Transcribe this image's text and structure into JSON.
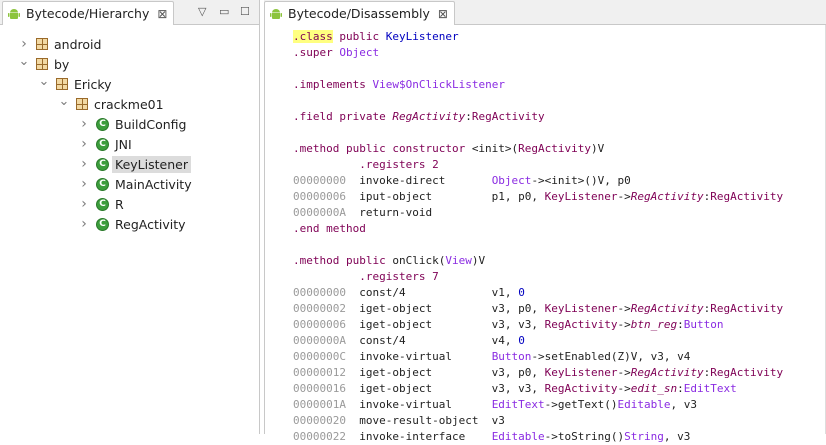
{
  "left_tab": {
    "title": "Bytecode/Hierarchy",
    "close": "⊠"
  },
  "left_controls": {
    "menu": "▽",
    "minimize": "▭",
    "maximize": "☐"
  },
  "tree": [
    {
      "label": "android",
      "type": "package",
      "depth": 0,
      "expanded": false
    },
    {
      "label": "by",
      "type": "package",
      "depth": 0,
      "expanded": true
    },
    {
      "label": "Ericky",
      "type": "package",
      "depth": 1,
      "expanded": true
    },
    {
      "label": "crackme01",
      "type": "package",
      "depth": 2,
      "expanded": true
    },
    {
      "label": "BuildConfig",
      "type": "class",
      "depth": 3,
      "expanded": false
    },
    {
      "label": "JNI",
      "type": "class",
      "depth": 3,
      "expanded": false
    },
    {
      "label": "KeyListener",
      "type": "class",
      "depth": 3,
      "expanded": false,
      "selected": true
    },
    {
      "label": "MainActivity",
      "type": "class",
      "depth": 3,
      "expanded": false
    },
    {
      "label": "R",
      "type": "class",
      "depth": 3,
      "expanded": false
    },
    {
      "label": "RegActivity",
      "type": "class",
      "depth": 3,
      "expanded": false
    }
  ],
  "class_icon_letter": "C",
  "right_tab": {
    "title": "Bytecode/Disassembly",
    "close": "⊠"
  },
  "code_lines": [
    [
      {
        "t": ".class",
        "c": "kw hilite"
      },
      {
        "t": " public ",
        "c": "kw"
      },
      {
        "t": "KeyListener",
        "c": "id"
      }
    ],
    [
      {
        "t": ".super ",
        "c": "kw"
      },
      {
        "t": "Object",
        "c": "type"
      }
    ],
    [],
    [
      {
        "t": ".implements ",
        "c": "kw"
      },
      {
        "t": "View$OnClickListener",
        "c": "type"
      }
    ],
    [],
    [
      {
        "t": ".field private ",
        "c": "kw"
      },
      {
        "t": "RegActivity",
        "c": "cls it"
      },
      {
        "t": ":",
        "c": "plain"
      },
      {
        "t": "RegActivity",
        "c": "cls"
      }
    ],
    [],
    [
      {
        "t": ".method public constructor ",
        "c": "kw"
      },
      {
        "t": "<init>(",
        "c": "plain"
      },
      {
        "t": "RegActivity",
        "c": "cls"
      },
      {
        "t": ")V",
        "c": "plain"
      }
    ],
    [
      {
        "t": "          .registers 2",
        "c": "kw"
      }
    ],
    [
      {
        "t": "00000000  ",
        "c": "gray"
      },
      {
        "t": "invoke-direct       ",
        "c": "plain"
      },
      {
        "t": "Object",
        "c": "type"
      },
      {
        "t": "-><init>()V, p0",
        "c": "plain"
      }
    ],
    [
      {
        "t": "00000006  ",
        "c": "gray"
      },
      {
        "t": "iput-object         p1, p0, ",
        "c": "plain"
      },
      {
        "t": "KeyListener",
        "c": "cls"
      },
      {
        "t": "->",
        "c": "plain"
      },
      {
        "t": "RegActivity",
        "c": "cls it"
      },
      {
        "t": ":",
        "c": "plain"
      },
      {
        "t": "RegActivity",
        "c": "cls"
      }
    ],
    [
      {
        "t": "0000000A  ",
        "c": "gray"
      },
      {
        "t": "return-void",
        "c": "plain"
      }
    ],
    [
      {
        "t": ".end method",
        "c": "kw"
      }
    ],
    [],
    [
      {
        "t": ".method public ",
        "c": "kw"
      },
      {
        "t": "onClick(",
        "c": "plain"
      },
      {
        "t": "View",
        "c": "type"
      },
      {
        "t": ")V",
        "c": "plain"
      }
    ],
    [
      {
        "t": "          .registers 7",
        "c": "kw"
      }
    ],
    [
      {
        "t": "00000000  ",
        "c": "gray"
      },
      {
        "t": "const/4             v1, ",
        "c": "plain"
      },
      {
        "t": "0",
        "c": "id"
      }
    ],
    [
      {
        "t": "00000002  ",
        "c": "gray"
      },
      {
        "t": "iget-object         v3, p0, ",
        "c": "plain"
      },
      {
        "t": "KeyListener",
        "c": "cls"
      },
      {
        "t": "->",
        "c": "plain"
      },
      {
        "t": "RegActivity",
        "c": "cls it"
      },
      {
        "t": ":",
        "c": "plain"
      },
      {
        "t": "RegActivity",
        "c": "cls"
      }
    ],
    [
      {
        "t": "00000006  ",
        "c": "gray"
      },
      {
        "t": "iget-object         v3, v3, ",
        "c": "plain"
      },
      {
        "t": "RegActivity",
        "c": "cls"
      },
      {
        "t": "->",
        "c": "plain"
      },
      {
        "t": "btn_reg",
        "c": "cls it"
      },
      {
        "t": ":",
        "c": "plain"
      },
      {
        "t": "Button",
        "c": "type"
      }
    ],
    [
      {
        "t": "0000000A  ",
        "c": "gray"
      },
      {
        "t": "const/4             v4, ",
        "c": "plain"
      },
      {
        "t": "0",
        "c": "id"
      }
    ],
    [
      {
        "t": "0000000C  ",
        "c": "gray"
      },
      {
        "t": "invoke-virtual      ",
        "c": "plain"
      },
      {
        "t": "Button",
        "c": "type"
      },
      {
        "t": "->setEnabled(Z)V, v3, v4",
        "c": "plain"
      }
    ],
    [
      {
        "t": "00000012  ",
        "c": "gray"
      },
      {
        "t": "iget-object         v3, p0, ",
        "c": "plain"
      },
      {
        "t": "KeyListener",
        "c": "cls"
      },
      {
        "t": "->",
        "c": "plain"
      },
      {
        "t": "RegActivity",
        "c": "cls it"
      },
      {
        "t": ":",
        "c": "plain"
      },
      {
        "t": "RegActivity",
        "c": "cls"
      }
    ],
    [
      {
        "t": "00000016  ",
        "c": "gray"
      },
      {
        "t": "iget-object         v3, v3, ",
        "c": "plain"
      },
      {
        "t": "RegActivity",
        "c": "cls"
      },
      {
        "t": "->",
        "c": "plain"
      },
      {
        "t": "edit_sn",
        "c": "cls it"
      },
      {
        "t": ":",
        "c": "plain"
      },
      {
        "t": "EditText",
        "c": "type"
      }
    ],
    [
      {
        "t": "0000001A  ",
        "c": "gray"
      },
      {
        "t": "invoke-virtual      ",
        "c": "plain"
      },
      {
        "t": "EditText",
        "c": "type"
      },
      {
        "t": "->getText()",
        "c": "plain"
      },
      {
        "t": "Editable",
        "c": "type"
      },
      {
        "t": ", v3",
        "c": "plain"
      }
    ],
    [
      {
        "t": "00000020  ",
        "c": "gray"
      },
      {
        "t": "move-result-object  v3",
        "c": "plain"
      }
    ],
    [
      {
        "t": "00000022  ",
        "c": "gray"
      },
      {
        "t": "invoke-interface    ",
        "c": "plain"
      },
      {
        "t": "Editable",
        "c": "type"
      },
      {
        "t": "->toString()",
        "c": "plain"
      },
      {
        "t": "String",
        "c": "type"
      },
      {
        "t": ", v3",
        "c": "plain"
      }
    ]
  ],
  "colors": {
    "keyword": "#7f0055",
    "type": "#8a2be2",
    "address": "#9a9a9a",
    "selection": "#dcdcdc",
    "highlight": "#ffff80"
  }
}
